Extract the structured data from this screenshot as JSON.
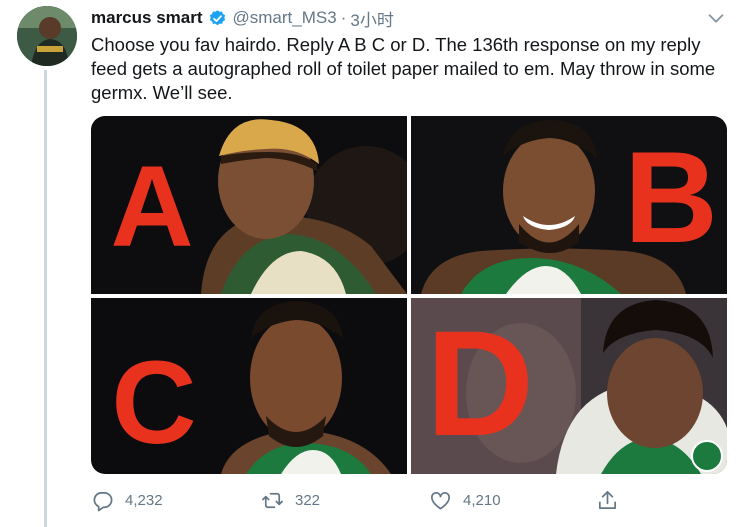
{
  "tweet": {
    "author": {
      "display_name": "marcus smart",
      "handle": "@smart_MS3",
      "verified": true
    },
    "time": "3小时",
    "separator": "·",
    "text": "Choose you fav hairdo. Reply A B C or D. The 136th response on my reply feed gets a autographed roll of toilet paper mailed to em. May throw in some germx. We’ll see.",
    "media": [
      {
        "letter": "A",
        "color": "#e8321e"
      },
      {
        "letter": "B",
        "color": "#e8321e"
      },
      {
        "letter": "C",
        "color": "#e8321e"
      },
      {
        "letter": "D",
        "color": "#e8321e"
      }
    ],
    "actions": {
      "replies": "4,232",
      "retweets": "322",
      "likes": "4,210"
    }
  },
  "icons": {
    "verified": "verified-badge-icon",
    "menu": "chevron-down-icon",
    "reply": "reply-icon",
    "retweet": "retweet-icon",
    "like": "heart-icon",
    "share": "share-icon"
  },
  "colors": {
    "accent": "#1da1f2",
    "muted": "#657786",
    "text": "#14171a",
    "celtics_green": "#1c7a3e",
    "bucks_green": "#2f5b32"
  }
}
